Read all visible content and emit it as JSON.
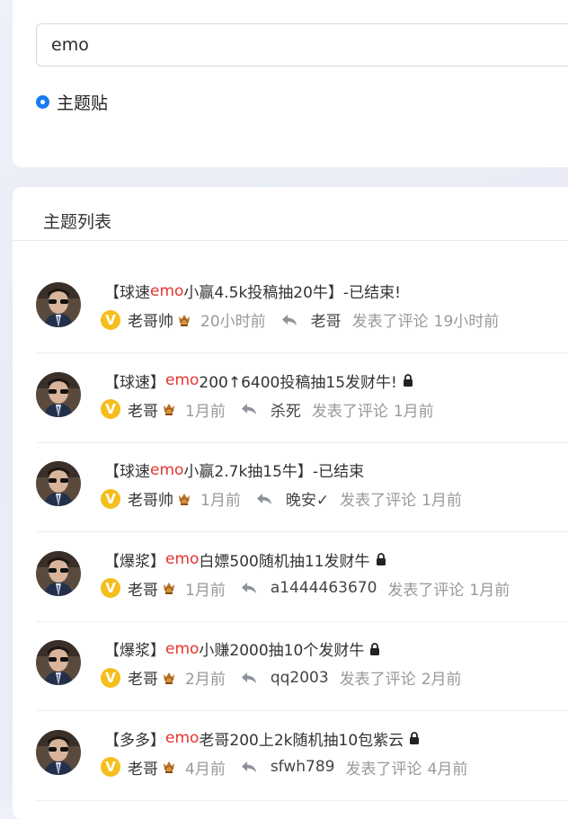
{
  "search": {
    "value": "emo"
  },
  "filter": {
    "option_label": "主题贴"
  },
  "list": {
    "title": "主题列表",
    "topics": [
      {
        "prefix": "【球速",
        "kw": "emo",
        "suffix": "小赢4.5k投稿抽20牛】-已结束!",
        "locked": false,
        "author": "老哥帅",
        "time": "20小时前",
        "replier": "老哥",
        "action": "发表了评论",
        "reply_time": "19小时前"
      },
      {
        "prefix": "【球速】",
        "kw": "emo",
        "suffix": " 200↑6400投稿抽15发财牛!",
        "locked": true,
        "author": "老哥",
        "time": "1月前",
        "replier": "杀死",
        "action": "发表了评论",
        "reply_time": "1月前"
      },
      {
        "prefix": "【球速 ",
        "kw": "emo",
        "suffix": " 小赢2.7k抽15牛】-已结束",
        "locked": false,
        "author": "老哥帅",
        "time": "1月前",
        "replier": "晚安✓",
        "action": "发表了评论",
        "reply_time": "1月前"
      },
      {
        "prefix": "【爆浆】",
        "kw": "emo",
        "suffix": "白嫖500随机抽11发财牛",
        "locked": true,
        "author": "老哥",
        "time": "1月前",
        "replier": "a1444463670",
        "action": "发表了评论",
        "reply_time": "1月前"
      },
      {
        "prefix": "【爆浆】",
        "kw": "emo",
        "suffix": "小赚2000抽10个发财牛",
        "locked": true,
        "author": "老哥",
        "time": "2月前",
        "replier": "qq2003",
        "action": "发表了评论",
        "reply_time": "2月前"
      },
      {
        "prefix": "【多多】",
        "kw": "emo",
        "suffix": "老哥200上2k随机抽10包紫云",
        "locked": true,
        "author": "老哥",
        "time": "4月前",
        "replier": "sfwh789",
        "action": "发表了评论",
        "reply_time": "4月前"
      }
    ]
  },
  "colors": {
    "accent": "#1a7bf2",
    "keyword": "#e5352f",
    "vip": "#f4be1c"
  }
}
